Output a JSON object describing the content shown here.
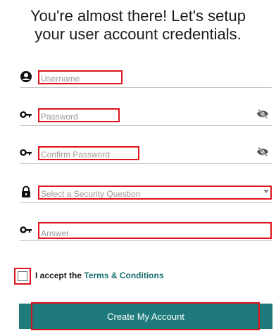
{
  "header": {
    "title_line1": "You're almost there! Let's setup",
    "title_line2": "your user account credentials."
  },
  "fields": {
    "username": {
      "placeholder": "Username",
      "icon": "user-circle-icon"
    },
    "password": {
      "placeholder": "Password",
      "icon": "key-icon",
      "toggle_icon": "eye-slash-icon"
    },
    "confirm_password": {
      "placeholder": "Confirm Password",
      "icon": "key-icon",
      "toggle_icon": "eye-slash-icon"
    },
    "security_question": {
      "placeholder": "Select a Security Question",
      "icon": "lock-icon"
    },
    "answer": {
      "placeholder": "Answer",
      "icon": "key-icon"
    }
  },
  "terms": {
    "prefix": "I accept the",
    "link": "Terms & Conditions"
  },
  "actions": {
    "create_label": "Create My Account"
  },
  "colors": {
    "accent": "#1f7b7b",
    "highlight": "#e0121b"
  }
}
